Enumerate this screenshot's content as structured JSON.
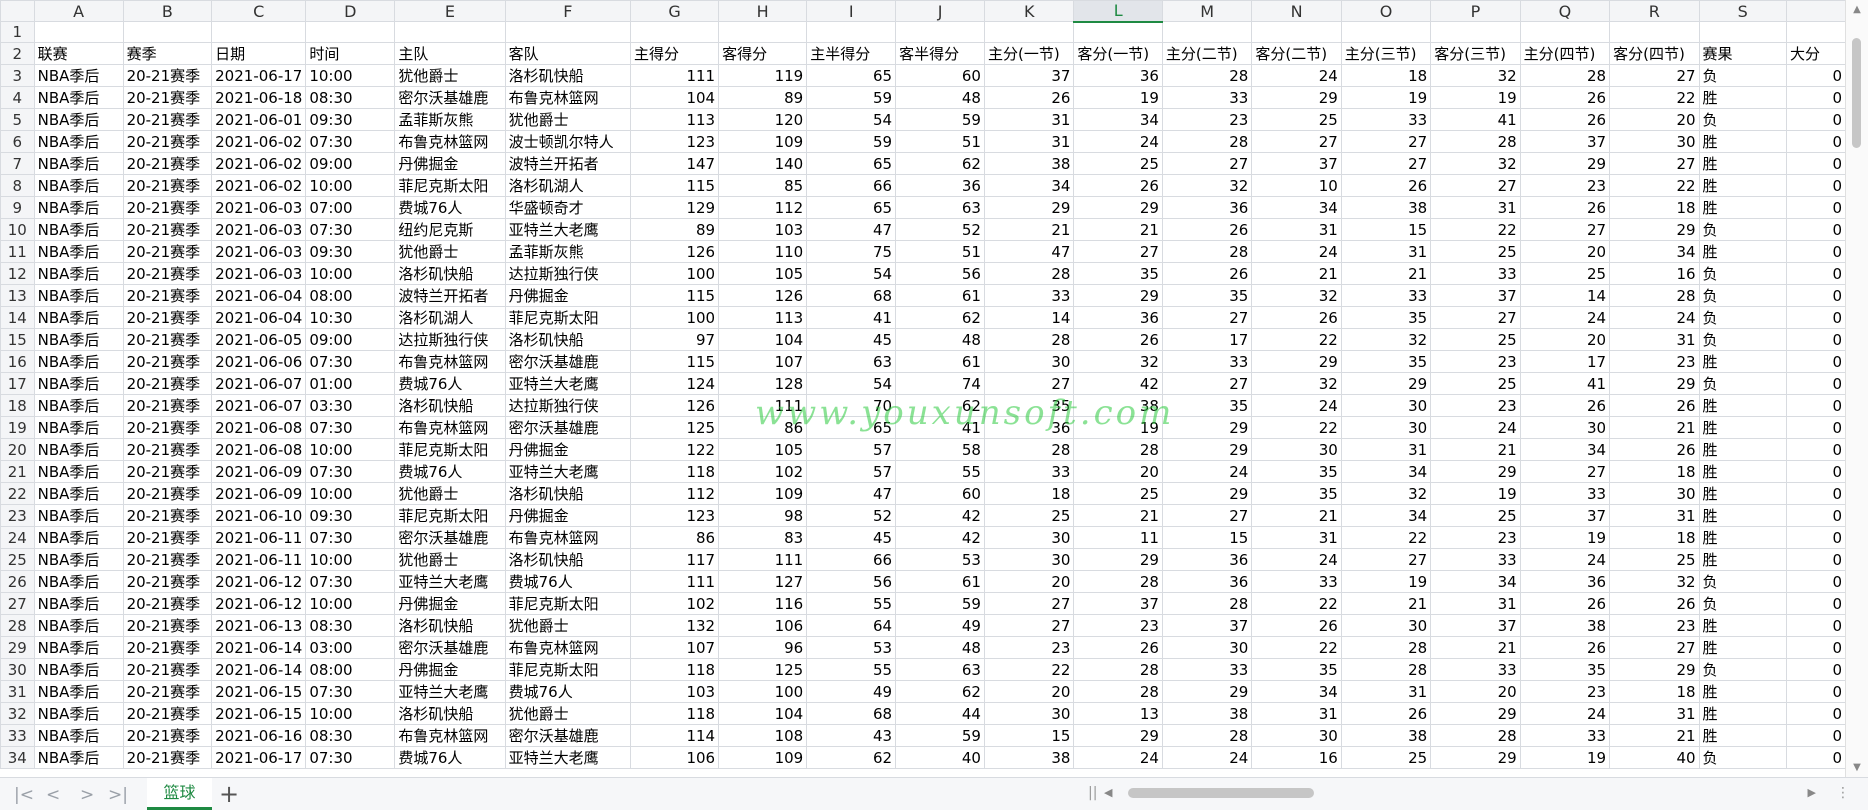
{
  "sheet": {
    "selected_column": "L",
    "columns": [
      "A",
      "B",
      "C",
      "D",
      "E",
      "F",
      "G",
      "H",
      "I",
      "J",
      "K",
      "L",
      "M",
      "N",
      "O",
      "P",
      "Q",
      "R",
      "S",
      ""
    ],
    "rows": [
      {
        "n": "1",
        "cells": [
          "",
          "",
          "",
          "",
          "",
          "",
          "",
          "",
          "",
          "",
          "",
          "",
          "",
          "",
          "",
          "",
          "",
          "",
          "",
          ""
        ]
      },
      {
        "n": "2",
        "cells": [
          "联赛",
          "赛季",
          "日期",
          "时间",
          "主队",
          "客队",
          "主得分",
          "客得分",
          "主半得分",
          "客半得分",
          "主分(一节)",
          "客分(一节)",
          "主分(二节)",
          "客分(二节)",
          "主分(三节)",
          "客分(三节)",
          "主分(四节)",
          "客分(四节)",
          "赛果",
          "大分"
        ]
      },
      {
        "n": "3",
        "cells": [
          "NBA季后",
          "20-21赛季",
          "2021-06-17",
          "10:00",
          "犹他爵士",
          "洛杉矶快船",
          "111",
          "119",
          "65",
          "60",
          "37",
          "36",
          "28",
          "24",
          "18",
          "32",
          "28",
          "27",
          "负",
          "0"
        ]
      },
      {
        "n": "4",
        "cells": [
          "NBA季后",
          "20-21赛季",
          "2021-06-18",
          "08:30",
          "密尔沃基雄鹿",
          "布鲁克林篮网",
          "104",
          "89",
          "59",
          "48",
          "26",
          "19",
          "33",
          "29",
          "19",
          "19",
          "26",
          "22",
          "胜",
          "0"
        ]
      },
      {
        "n": "5",
        "cells": [
          "NBA季后",
          "20-21赛季",
          "2021-06-01",
          "09:30",
          "孟菲斯灰熊",
          "犹他爵士",
          "113",
          "120",
          "54",
          "59",
          "31",
          "34",
          "23",
          "25",
          "33",
          "41",
          "26",
          "20",
          "负",
          "0"
        ]
      },
      {
        "n": "6",
        "cells": [
          "NBA季后",
          "20-21赛季",
          "2021-06-02",
          "07:30",
          "布鲁克林篮网",
          "波士顿凯尔特人",
          "123",
          "109",
          "59",
          "51",
          "31",
          "24",
          "28",
          "27",
          "27",
          "28",
          "37",
          "30",
          "胜",
          "0"
        ]
      },
      {
        "n": "7",
        "cells": [
          "NBA季后",
          "20-21赛季",
          "2021-06-02",
          "09:00",
          "丹佛掘金",
          "波特兰开拓者",
          "147",
          "140",
          "65",
          "62",
          "38",
          "25",
          "27",
          "37",
          "27",
          "32",
          "29",
          "27",
          "胜",
          "0"
        ]
      },
      {
        "n": "8",
        "cells": [
          "NBA季后",
          "20-21赛季",
          "2021-06-02",
          "10:00",
          "菲尼克斯太阳",
          "洛杉矶湖人",
          "115",
          "85",
          "66",
          "36",
          "34",
          "26",
          "32",
          "10",
          "26",
          "27",
          "23",
          "22",
          "胜",
          "0"
        ]
      },
      {
        "n": "9",
        "cells": [
          "NBA季后",
          "20-21赛季",
          "2021-06-03",
          "07:00",
          "费城76人",
          "华盛顿奇才",
          "129",
          "112",
          "65",
          "63",
          "29",
          "29",
          "36",
          "34",
          "38",
          "31",
          "26",
          "18",
          "胜",
          "0"
        ]
      },
      {
        "n": "10",
        "cells": [
          "NBA季后",
          "20-21赛季",
          "2021-06-03",
          "07:30",
          "纽约尼克斯",
          "亚特兰大老鹰",
          "89",
          "103",
          "47",
          "52",
          "21",
          "21",
          "26",
          "31",
          "15",
          "22",
          "27",
          "29",
          "负",
          "0"
        ]
      },
      {
        "n": "11",
        "cells": [
          "NBA季后",
          "20-21赛季",
          "2021-06-03",
          "09:30",
          "犹他爵士",
          "孟菲斯灰熊",
          "126",
          "110",
          "75",
          "51",
          "47",
          "27",
          "28",
          "24",
          "31",
          "25",
          "20",
          "34",
          "胜",
          "0"
        ]
      },
      {
        "n": "12",
        "cells": [
          "NBA季后",
          "20-21赛季",
          "2021-06-03",
          "10:00",
          "洛杉矶快船",
          "达拉斯独行侠",
          "100",
          "105",
          "54",
          "56",
          "28",
          "35",
          "26",
          "21",
          "21",
          "33",
          "25",
          "16",
          "负",
          "0"
        ]
      },
      {
        "n": "13",
        "cells": [
          "NBA季后",
          "20-21赛季",
          "2021-06-04",
          "08:00",
          "波特兰开拓者",
          "丹佛掘金",
          "115",
          "126",
          "68",
          "61",
          "33",
          "29",
          "35",
          "32",
          "33",
          "37",
          "14",
          "28",
          "负",
          "0"
        ]
      },
      {
        "n": "14",
        "cells": [
          "NBA季后",
          "20-21赛季",
          "2021-06-04",
          "10:30",
          "洛杉矶湖人",
          "菲尼克斯太阳",
          "100",
          "113",
          "41",
          "62",
          "14",
          "36",
          "27",
          "26",
          "35",
          "27",
          "24",
          "24",
          "负",
          "0"
        ]
      },
      {
        "n": "15",
        "cells": [
          "NBA季后",
          "20-21赛季",
          "2021-06-05",
          "09:00",
          "达拉斯独行侠",
          "洛杉矶快船",
          "97",
          "104",
          "45",
          "48",
          "28",
          "26",
          "17",
          "22",
          "32",
          "25",
          "20",
          "31",
          "负",
          "0"
        ]
      },
      {
        "n": "16",
        "cells": [
          "NBA季后",
          "20-21赛季",
          "2021-06-06",
          "07:30",
          "布鲁克林篮网",
          "密尔沃基雄鹿",
          "115",
          "107",
          "63",
          "61",
          "30",
          "32",
          "33",
          "29",
          "35",
          "23",
          "17",
          "23",
          "胜",
          "0"
        ]
      },
      {
        "n": "17",
        "cells": [
          "NBA季后",
          "20-21赛季",
          "2021-06-07",
          "01:00",
          "费城76人",
          "亚特兰大老鹰",
          "124",
          "128",
          "54",
          "74",
          "27",
          "42",
          "27",
          "32",
          "29",
          "25",
          "41",
          "29",
          "负",
          "0"
        ]
      },
      {
        "n": "18",
        "cells": [
          "NBA季后",
          "20-21赛季",
          "2021-06-07",
          "03:30",
          "洛杉矶快船",
          "达拉斯独行侠",
          "126",
          "111",
          "70",
          "62",
          "35",
          "38",
          "35",
          "24",
          "30",
          "23",
          "26",
          "26",
          "胜",
          "0"
        ]
      },
      {
        "n": "19",
        "cells": [
          "NBA季后",
          "20-21赛季",
          "2021-06-08",
          "07:30",
          "布鲁克林篮网",
          "密尔沃基雄鹿",
          "125",
          "86",
          "65",
          "41",
          "36",
          "19",
          "29",
          "22",
          "30",
          "24",
          "30",
          "21",
          "胜",
          "0"
        ]
      },
      {
        "n": "20",
        "cells": [
          "NBA季后",
          "20-21赛季",
          "2021-06-08",
          "10:00",
          "菲尼克斯太阳",
          "丹佛掘金",
          "122",
          "105",
          "57",
          "58",
          "28",
          "28",
          "29",
          "30",
          "31",
          "21",
          "34",
          "26",
          "胜",
          "0"
        ]
      },
      {
        "n": "21",
        "cells": [
          "NBA季后",
          "20-21赛季",
          "2021-06-09",
          "07:30",
          "费城76人",
          "亚特兰大老鹰",
          "118",
          "102",
          "57",
          "55",
          "33",
          "20",
          "24",
          "35",
          "34",
          "29",
          "27",
          "18",
          "胜",
          "0"
        ]
      },
      {
        "n": "22",
        "cells": [
          "NBA季后",
          "20-21赛季",
          "2021-06-09",
          "10:00",
          "犹他爵士",
          "洛杉矶快船",
          "112",
          "109",
          "47",
          "60",
          "18",
          "25",
          "29",
          "35",
          "32",
          "19",
          "33",
          "30",
          "胜",
          "0"
        ]
      },
      {
        "n": "23",
        "cells": [
          "NBA季后",
          "20-21赛季",
          "2021-06-10",
          "09:30",
          "菲尼克斯太阳",
          "丹佛掘金",
          "123",
          "98",
          "52",
          "42",
          "25",
          "21",
          "27",
          "21",
          "34",
          "25",
          "37",
          "31",
          "胜",
          "0"
        ]
      },
      {
        "n": "24",
        "cells": [
          "NBA季后",
          "20-21赛季",
          "2021-06-11",
          "07:30",
          "密尔沃基雄鹿",
          "布鲁克林篮网",
          "86",
          "83",
          "45",
          "42",
          "30",
          "11",
          "15",
          "31",
          "22",
          "23",
          "19",
          "18",
          "胜",
          "0"
        ]
      },
      {
        "n": "25",
        "cells": [
          "NBA季后",
          "20-21赛季",
          "2021-06-11",
          "10:00",
          "犹他爵士",
          "洛杉矶快船",
          "117",
          "111",
          "66",
          "53",
          "30",
          "29",
          "36",
          "24",
          "27",
          "33",
          "24",
          "25",
          "胜",
          "0"
        ]
      },
      {
        "n": "26",
        "cells": [
          "NBA季后",
          "20-21赛季",
          "2021-06-12",
          "07:30",
          "亚特兰大老鹰",
          "费城76人",
          "111",
          "127",
          "56",
          "61",
          "20",
          "28",
          "36",
          "33",
          "19",
          "34",
          "36",
          "32",
          "负",
          "0"
        ]
      },
      {
        "n": "27",
        "cells": [
          "NBA季后",
          "20-21赛季",
          "2021-06-12",
          "10:00",
          "丹佛掘金",
          "菲尼克斯太阳",
          "102",
          "116",
          "55",
          "59",
          "27",
          "37",
          "28",
          "22",
          "21",
          "31",
          "26",
          "26",
          "负",
          "0"
        ]
      },
      {
        "n": "28",
        "cells": [
          "NBA季后",
          "20-21赛季",
          "2021-06-13",
          "08:30",
          "洛杉矶快船",
          "犹他爵士",
          "132",
          "106",
          "64",
          "49",
          "27",
          "23",
          "37",
          "26",
          "30",
          "37",
          "38",
          "23",
          "胜",
          "0"
        ]
      },
      {
        "n": "29",
        "cells": [
          "NBA季后",
          "20-21赛季",
          "2021-06-14",
          "03:00",
          "密尔沃基雄鹿",
          "布鲁克林篮网",
          "107",
          "96",
          "53",
          "48",
          "23",
          "26",
          "30",
          "22",
          "28",
          "21",
          "26",
          "27",
          "胜",
          "0"
        ]
      },
      {
        "n": "30",
        "cells": [
          "NBA季后",
          "20-21赛季",
          "2021-06-14",
          "08:00",
          "丹佛掘金",
          "菲尼克斯太阳",
          "118",
          "125",
          "55",
          "63",
          "22",
          "28",
          "33",
          "35",
          "28",
          "33",
          "35",
          "29",
          "负",
          "0"
        ]
      },
      {
        "n": "31",
        "cells": [
          "NBA季后",
          "20-21赛季",
          "2021-06-15",
          "07:30",
          "亚特兰大老鹰",
          "费城76人",
          "103",
          "100",
          "49",
          "62",
          "20",
          "28",
          "29",
          "34",
          "31",
          "20",
          "23",
          "18",
          "胜",
          "0"
        ]
      },
      {
        "n": "32",
        "cells": [
          "NBA季后",
          "20-21赛季",
          "2021-06-15",
          "10:00",
          "洛杉矶快船",
          "犹他爵士",
          "118",
          "104",
          "68",
          "44",
          "30",
          "13",
          "38",
          "31",
          "26",
          "29",
          "24",
          "31",
          "胜",
          "0"
        ]
      },
      {
        "n": "33",
        "cells": [
          "NBA季后",
          "20-21赛季",
          "2021-06-16",
          "08:30",
          "布鲁克林篮网",
          "密尔沃基雄鹿",
          "114",
          "108",
          "43",
          "59",
          "15",
          "29",
          "28",
          "30",
          "38",
          "28",
          "33",
          "21",
          "胜",
          "0"
        ]
      },
      {
        "n": "34",
        "cells": [
          "NBA季后",
          "20-21赛季",
          "2021-06-17",
          "07:30",
          "费城76人",
          "亚特兰大老鹰",
          "106",
          "109",
          "62",
          "40",
          "38",
          "24",
          "24",
          "16",
          "25",
          "29",
          "19",
          "40",
          "负",
          "0"
        ]
      }
    ]
  },
  "watermark_text": "www.youxunsoft.com",
  "bottom_bar": {
    "nav_first": "|<",
    "nav_prev": "<",
    "nav_next": ">",
    "nav_last": ">|",
    "active_sheet": "篮球",
    "add_sheet": "+"
  },
  "colors": {
    "accent": "#1e8a42",
    "grid_line": "#d8dbe0",
    "header_bg": "#f4f5f7"
  },
  "icons": {
    "nav_first": "first-sheet-icon",
    "nav_prev": "prev-sheet-icon",
    "nav_next": "next-sheet-icon",
    "nav_last": "last-sheet-icon",
    "add_sheet": "add-sheet-icon"
  }
}
